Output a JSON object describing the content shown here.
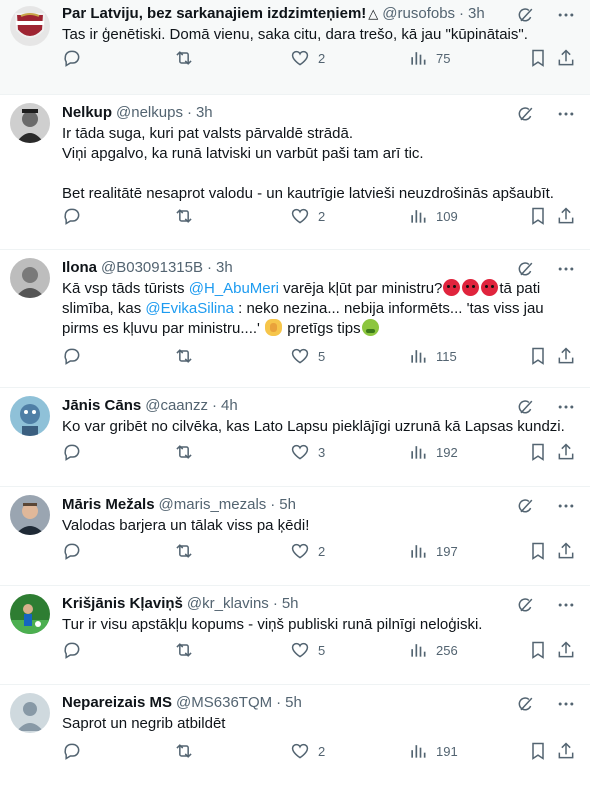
{
  "tweets": [
    {
      "name": "Par Latviju, bez sarkanajiem izdzimteņiem!",
      "badge": "△",
      "handle": "@rusofobs",
      "time": "3h",
      "text": "Tas ir ģenētiski. Domā vienu, saka citu, dara trešo, kā jau \"kūpinātais\".",
      "replies": "",
      "retweets": "",
      "likes": "2",
      "views": "75"
    },
    {
      "name": "Nelkup",
      "handle": "@nelkups",
      "time": "3h",
      "text": "Ir tāda suga, kuri pat valsts pārvaldē strādā.\nViņi apgalvo, ka runā latviski un varbūt paši tam arī tic.\n\nBet realitātē nesaprot valodu - un kautrīgie latvieši neuzdrošinās apšaubīt.",
      "replies": "",
      "retweets": "",
      "likes": "2",
      "views": "109"
    },
    {
      "name": "Ilona",
      "handle": "@B03091315B",
      "time": "3h",
      "text_parts": {
        "p1": "Kā vsp tāds tūrists ",
        "mention1": "@H_AbuMeri",
        "p2": " varēja kļūt par ministru?",
        "p3": "tā pati slimība, kas ",
        "mention2": "@EvikaSilina",
        "p4": " : neko nezina... nebija informēts... 'tas viss jau pirms es kļuvu par ministru....' ",
        "p5": " pretīgs tips"
      },
      "replies": "",
      "retweets": "",
      "likes": "5",
      "views": "115"
    },
    {
      "name": "Jānis Cāns",
      "handle": "@caanzz",
      "time": "4h",
      "text": "Ko var gribēt no cilvēka, kas Lato Lapsu pieklājīgi uzrunā kā Lapsas kundzi.",
      "replies": "",
      "retweets": "",
      "likes": "3",
      "views": "192"
    },
    {
      "name": "Māris Mežals",
      "handle": "@maris_mezals",
      "time": "5h",
      "text": "Valodas barjera un tālak viss pa ķēdi!",
      "replies": "",
      "retweets": "",
      "likes": "2",
      "views": "197"
    },
    {
      "name": "Krišjānis Kļaviņš",
      "handle": "@kr_klavins",
      "time": "5h",
      "text": "Tur ir visu apstākļu kopums - viņš publiski runā pilnīgi neloģiski.",
      "replies": "",
      "retweets": "",
      "likes": "5",
      "views": "256"
    },
    {
      "name": "Nepareizais MS",
      "handle": "@MS636TQM",
      "time": "5h",
      "text": "Saprot un negrib atbildēt",
      "replies": "",
      "retweets": "",
      "likes": "2",
      "views": "191"
    }
  ],
  "icons": {
    "reply": "reply-icon",
    "retweet": "retweet-icon",
    "like": "heart-icon",
    "views": "views-icon",
    "bookmark": "bookmark-icon",
    "share": "share-icon",
    "grok": "grok-icon",
    "more": "more-icon"
  },
  "colors": {
    "text": "#0f1419",
    "secondary": "#536471",
    "mention": "#1d9bf0",
    "highlight_bg": "#f7f9f9",
    "divider": "#eff3f4"
  }
}
